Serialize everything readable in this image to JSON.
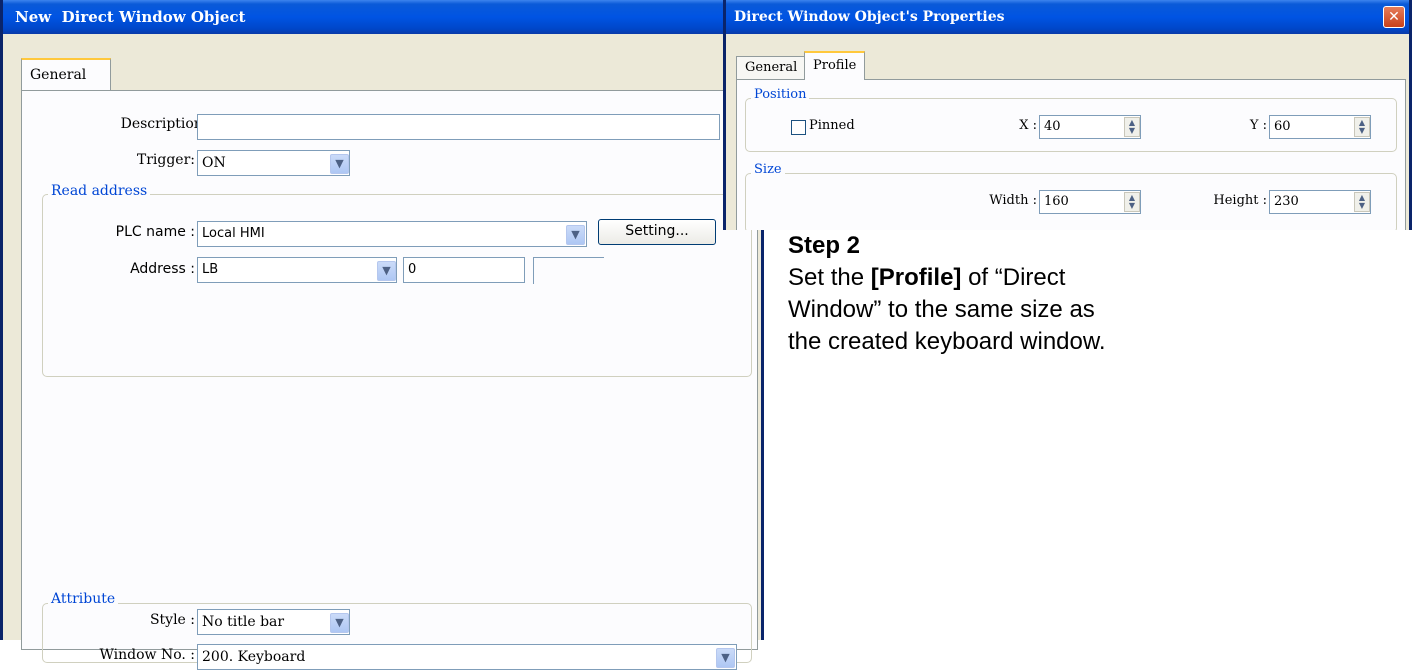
{
  "left_dialog": {
    "title": "New  Direct Window Object",
    "tabs": [
      {
        "label": "General"
      }
    ],
    "description": {
      "label": "Description :",
      "value": ""
    },
    "trigger": {
      "label": "Trigger:",
      "value": "ON"
    },
    "read_address": {
      "title": "Read address",
      "plc_name": {
        "label": "PLC name :",
        "value": "Local HMI"
      },
      "setting_button": "Setting...",
      "address": {
        "label": "Address :",
        "device": "LB",
        "value": "0"
      }
    },
    "attribute": {
      "title": "Attribute",
      "style": {
        "label": "Style :",
        "value": "No title bar"
      },
      "window_no": {
        "label": "Window No. :",
        "value": "200. Keyboard"
      }
    }
  },
  "right_dialog": {
    "title": "Direct Window Object's Properties",
    "close_glyph": "✕",
    "tabs": [
      {
        "label": "General"
      },
      {
        "label": "Profile"
      }
    ],
    "position": {
      "title": "Position",
      "pinned_label": "Pinned",
      "pinned_checked": false,
      "x": {
        "label": "X :",
        "value": "40"
      },
      "y": {
        "label": "Y :",
        "value": "60"
      }
    },
    "size": {
      "title": "Size",
      "width": {
        "label": "Width :",
        "value": "160"
      },
      "height": {
        "label": "Height :",
        "value": "230"
      }
    }
  },
  "caption": {
    "step": "Step 2",
    "line1_pre": "Set the ",
    "line1_bold": "[Profile]",
    "line1_post": " of “Direct",
    "line2": "Window” to the same size as",
    "line3": "the created keyboard window."
  },
  "icons": {
    "combo_arrow": "chevron-down-icon",
    "spinner": "spin-updown-icon",
    "close": "close-icon"
  },
  "colors": {
    "title_bar": "#0054e3",
    "dialog_bg": "#ece9d8",
    "group_title": "#0046d5",
    "tab_highlight": "#ffc83c",
    "close_button": "#c8401a"
  }
}
